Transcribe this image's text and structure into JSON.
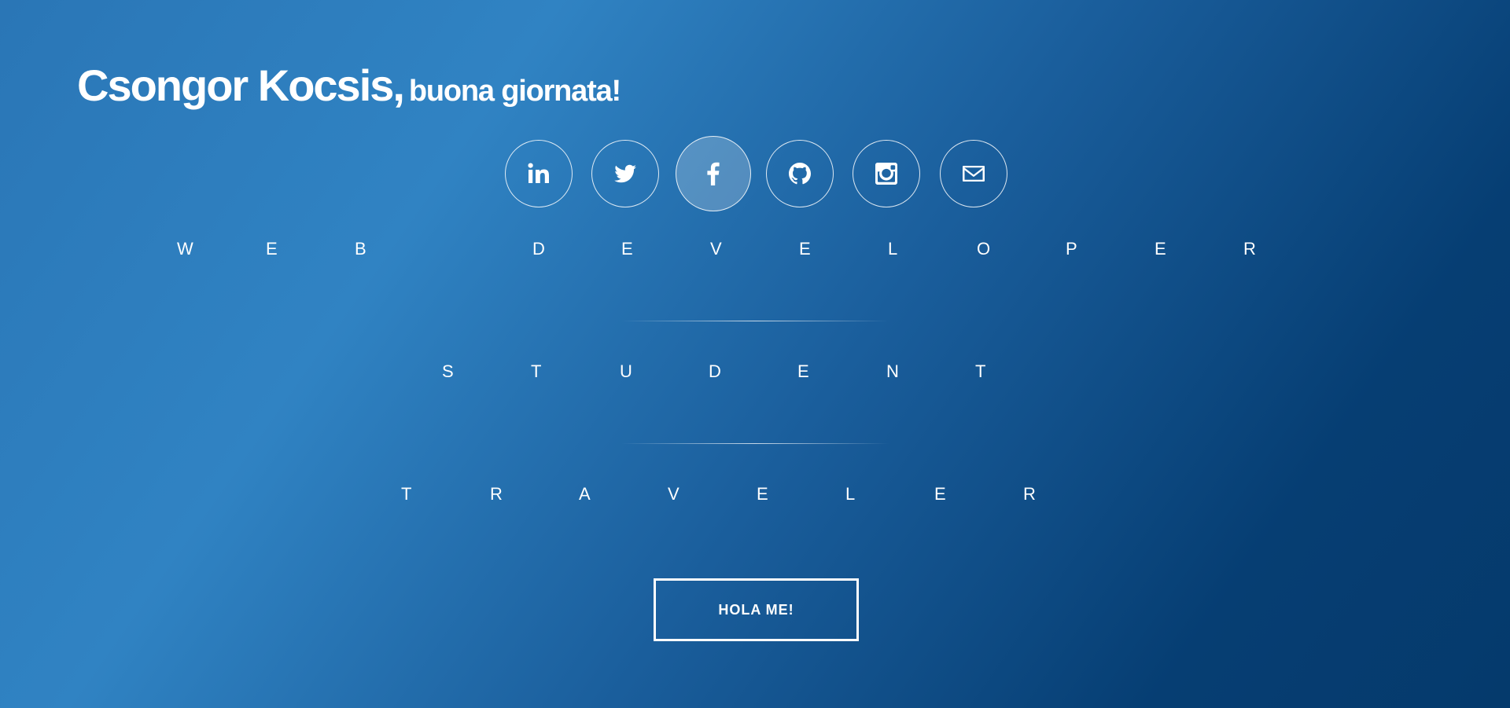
{
  "hero": {
    "name": "Csongor Kocsis,",
    "greeting": "buona giornata!"
  },
  "social": [
    {
      "icon": "linkedin-icon",
      "label": "LinkedIn"
    },
    {
      "icon": "twitter-icon",
      "label": "Twitter"
    },
    {
      "icon": "facebook-icon",
      "label": "Facebook"
    },
    {
      "icon": "github-icon",
      "label": "GitHub"
    },
    {
      "icon": "instagram-icon",
      "label": "Instagram"
    },
    {
      "icon": "email-icon",
      "label": "Email"
    }
  ],
  "roles": {
    "web_developer": [
      "W",
      "E",
      "B",
      " ",
      "D",
      "E",
      "V",
      "E",
      "L",
      "O",
      "P",
      "E",
      "R"
    ],
    "student": [
      "S",
      "T",
      "U",
      "D",
      "E",
      "N",
      "T"
    ],
    "traveler": [
      "T",
      "R",
      "A",
      "V",
      "E",
      "L",
      "E",
      "R"
    ]
  },
  "cta": {
    "label": "HOLA ME!"
  },
  "colors": {
    "text": "#ffffff",
    "background_light": "#3083c3",
    "background_dark": "#053a6c"
  }
}
